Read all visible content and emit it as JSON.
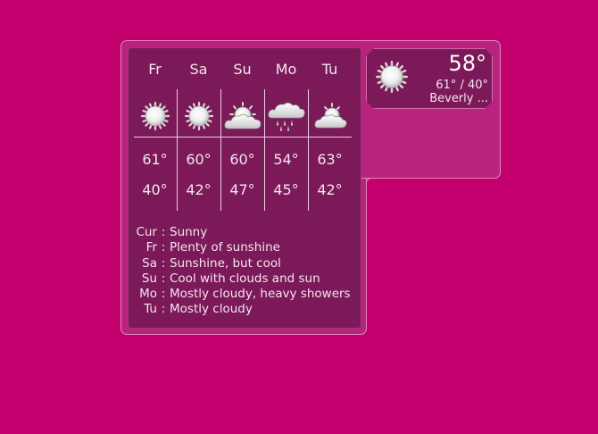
{
  "forecast": {
    "days": [
      {
        "label": "Fr",
        "icon": "sun-icon",
        "high": "61°",
        "low": "40°"
      },
      {
        "label": "Sa",
        "icon": "sun-icon",
        "high": "60°",
        "low": "42°"
      },
      {
        "label": "Su",
        "icon": "partly-cloudy-icon",
        "high": "60°",
        "low": "47°"
      },
      {
        "label": "Mo",
        "icon": "rain-cloud-icon",
        "high": "54°",
        "low": "45°"
      },
      {
        "label": "Tu",
        "icon": "mostly-cloudy-icon",
        "high": "63°",
        "low": "42°"
      }
    ],
    "descriptions": [
      {
        "key": "Cur",
        "text": "Sunny"
      },
      {
        "key": "Fr",
        "text": "Plenty of sunshine"
      },
      {
        "key": "Sa",
        "text": "Sunshine, but cool"
      },
      {
        "key": "Su",
        "text": "Cool with clouds and sun"
      },
      {
        "key": "Mo",
        "text": "Mostly cloudy, heavy showers"
      },
      {
        "key": "Tu",
        "text": "Mostly cloudy"
      }
    ],
    "separator": ":"
  },
  "current": {
    "icon": "sun-icon",
    "temperature": "58°",
    "range": "61° / 40°",
    "location": "Beverly ..."
  },
  "colors": {
    "background": "#c4006f",
    "panel": "#7c1958",
    "frame": "#b8237f",
    "text": "#f4e6ee"
  }
}
